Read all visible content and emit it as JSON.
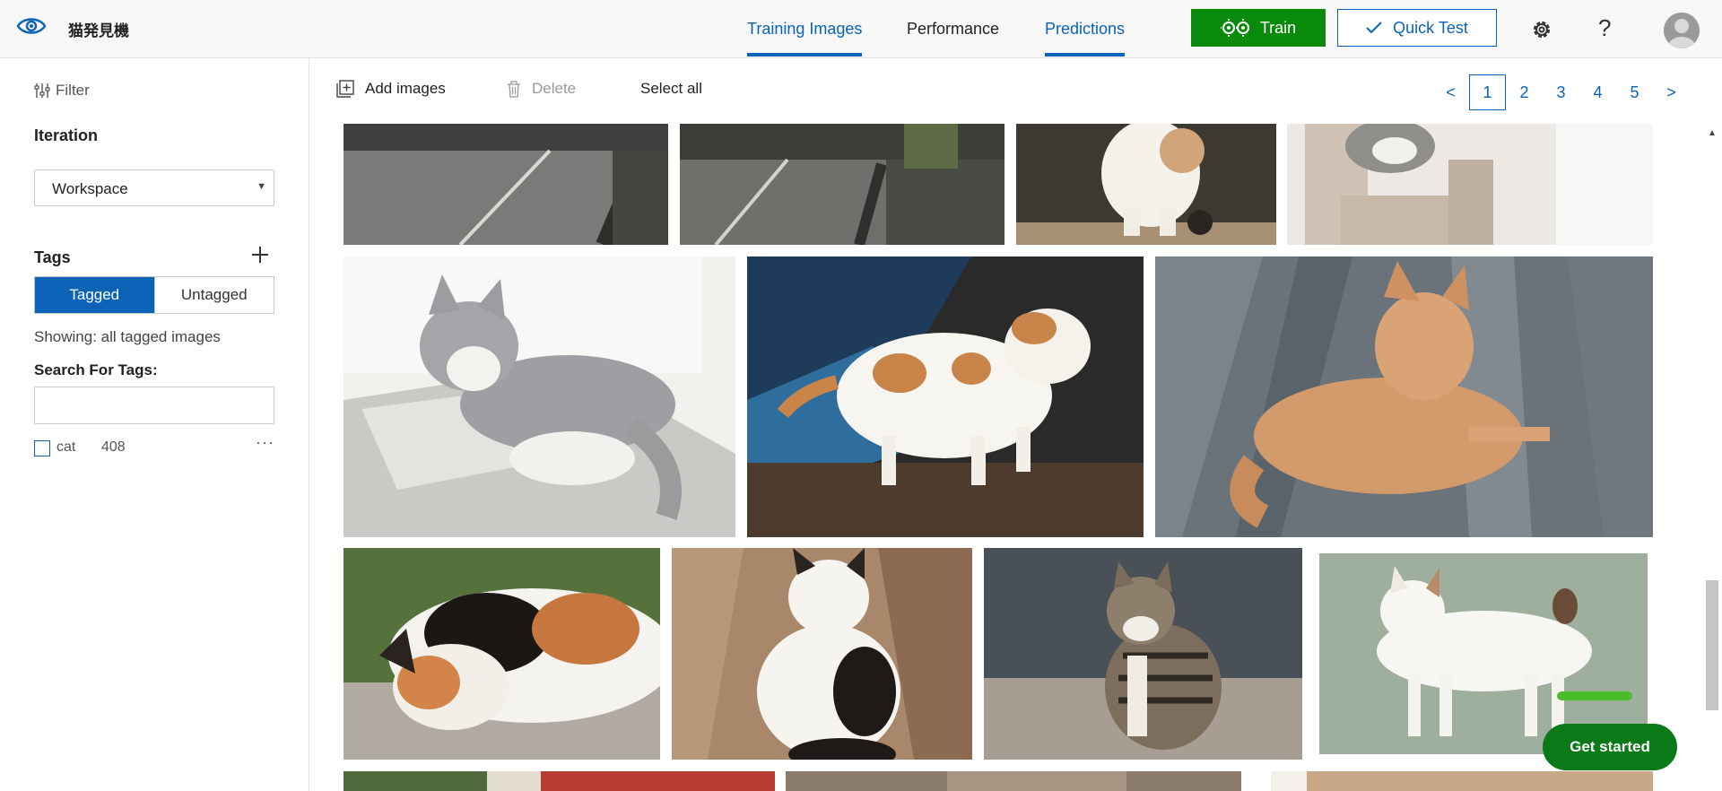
{
  "app": {
    "name": "猫発見機"
  },
  "nav": {
    "tabs": [
      {
        "label": "Training Images"
      },
      {
        "label": "Performance"
      },
      {
        "label": "Predictions"
      }
    ],
    "train_label": "Train",
    "quicktest_label": "Quick Test",
    "help_label": "?"
  },
  "sidebar": {
    "filter_label": "Filter",
    "iteration_label": "Iteration",
    "iteration_value": "Workspace",
    "tags_label": "Tags",
    "tagged_label": "Tagged",
    "untagged_label": "Untagged",
    "showing_text": "Showing: all tagged images",
    "search_label": "Search For Tags:",
    "search_value": "",
    "tags": [
      {
        "name": "cat",
        "count": "408"
      }
    ],
    "more_label": "···"
  },
  "toolbar": {
    "add_label": "Add images",
    "delete_label": "Delete",
    "select_all_label": "Select all"
  },
  "pager": {
    "prev": "<",
    "pages": [
      "1",
      "2",
      "3",
      "4",
      "5"
    ],
    "current": "1",
    "next": ">"
  },
  "get_started_label": "Get started",
  "colors": {
    "accent": "#0a63b7",
    "train": "#0a8a0a",
    "get_started": "#0a7a18"
  }
}
